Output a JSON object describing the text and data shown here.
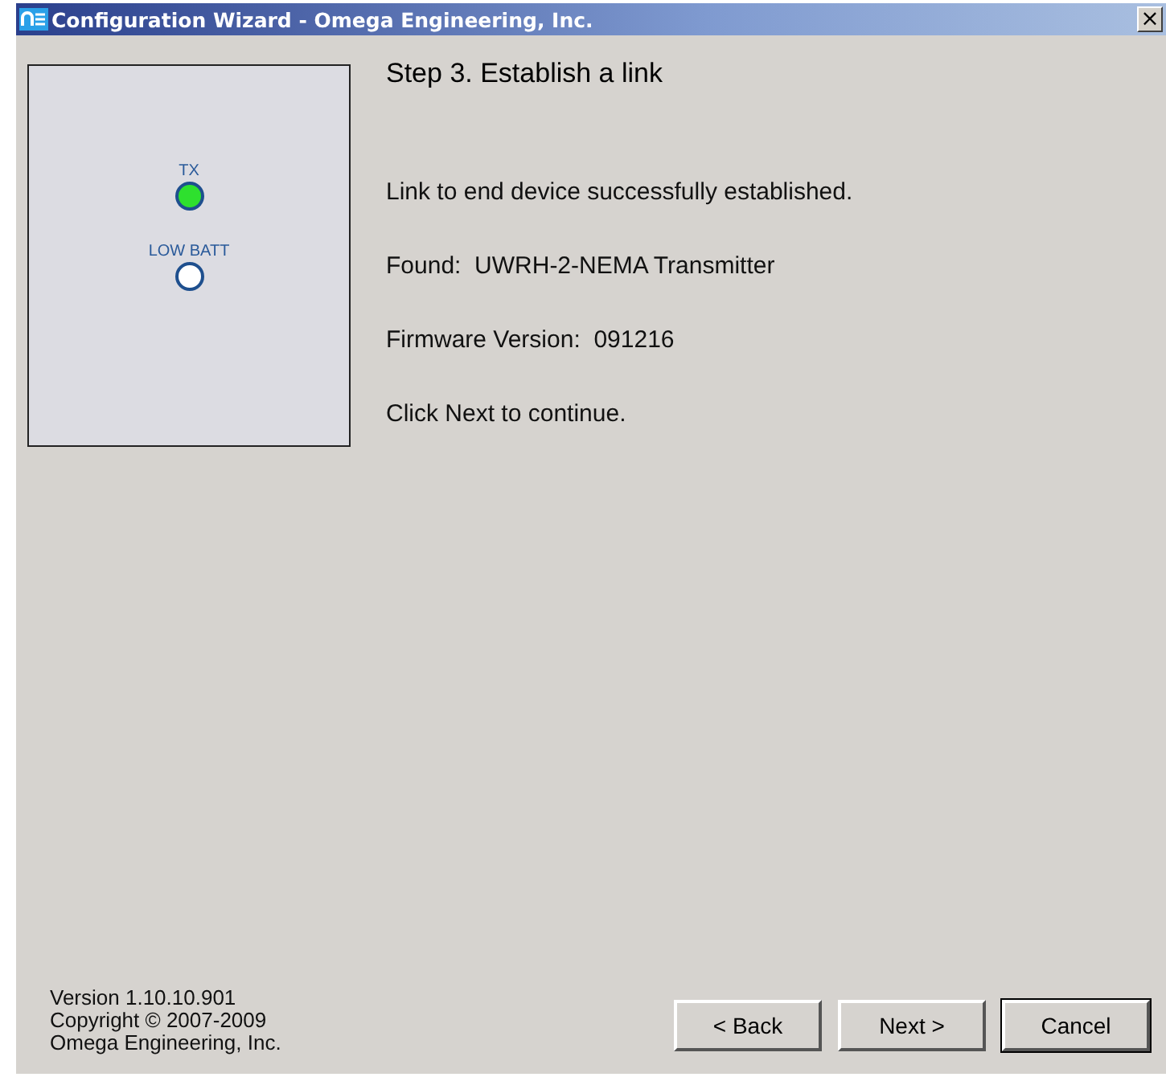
{
  "window": {
    "title": "Configuration Wizard - Omega Engineering, Inc.",
    "close": "×"
  },
  "indicators": [
    {
      "label": "TX",
      "on": true
    },
    {
      "label": "LOW BATT",
      "on": false
    }
  ],
  "step_title": "Step 3.  Establish a link",
  "messages": [
    "Link to end device successfully established.",
    "Found:  UWRH-2-NEMA Transmitter",
    "Firmware Version:  091216",
    "Click Next to continue."
  ],
  "footer": {
    "version": "Version 1.10.10.901",
    "copyright": "Copyright © 2007-2009",
    "company": "Omega Engineering, Inc."
  },
  "buttons": [
    {
      "label": "< Back",
      "default": false
    },
    {
      "label": "Next >",
      "default": false
    },
    {
      "label": "Cancel",
      "default": true
    }
  ]
}
